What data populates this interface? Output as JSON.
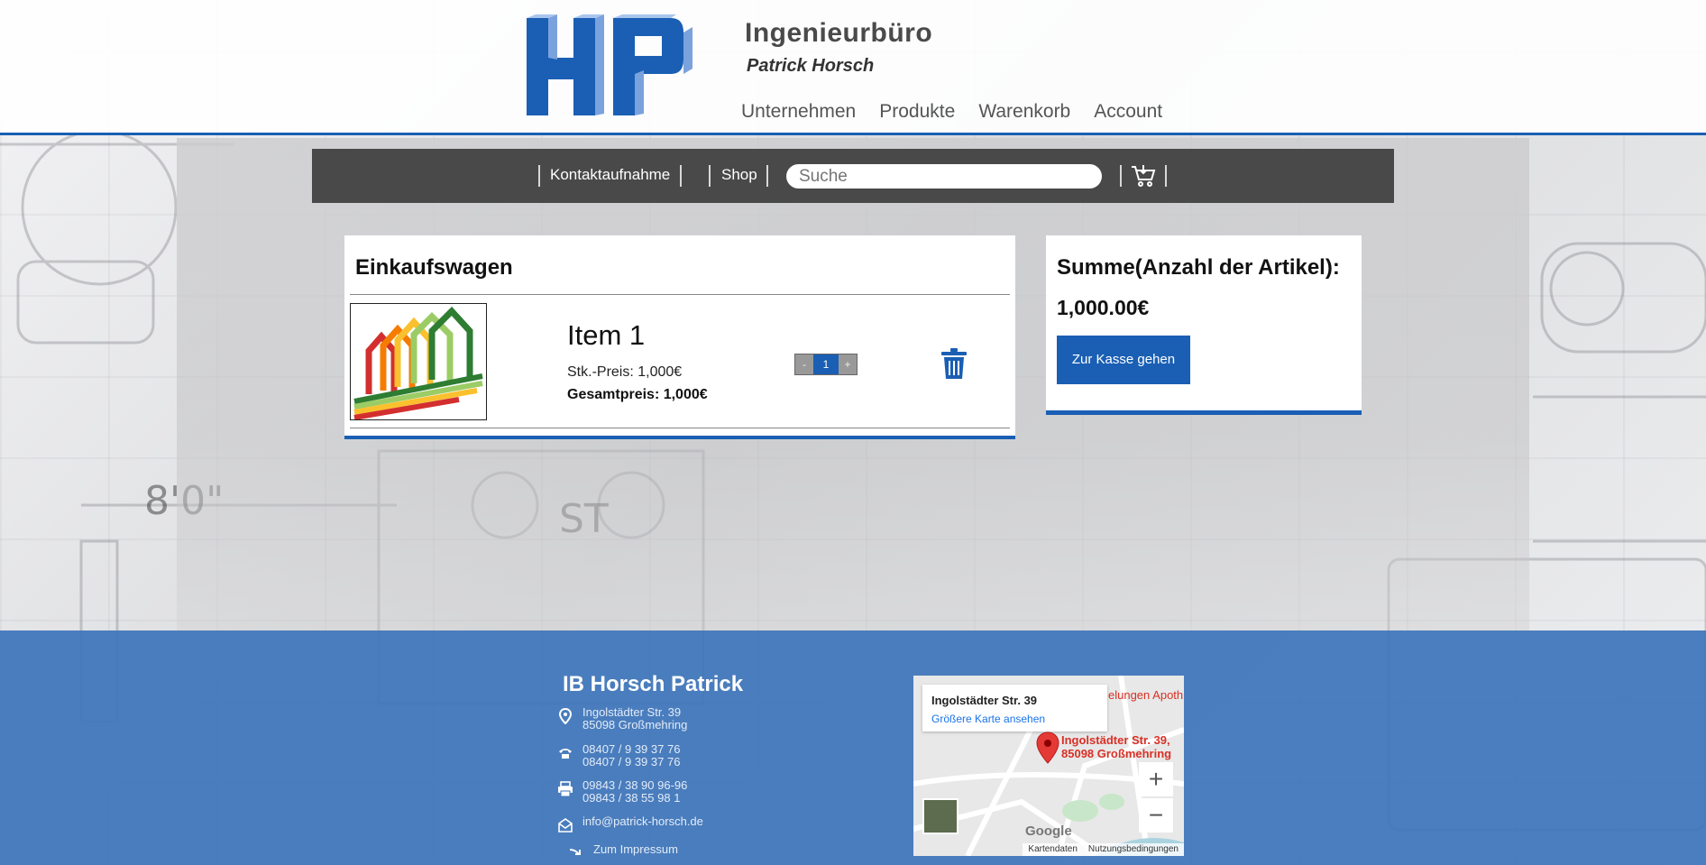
{
  "header": {
    "title": "Ingenieurbüro",
    "subtitle": "Patrick Horsch",
    "logo_text": "HP",
    "nav": [
      "Unternehmen",
      "Produkte",
      "Warenkorb",
      "Account"
    ]
  },
  "toolbar": {
    "contact_label": "Kontaktaufnahme",
    "shop_label": "Shop",
    "search_placeholder": "Suche",
    "cart_icon": "shopping-cart-icon"
  },
  "cart": {
    "title": "Einkaufswagen",
    "items": [
      {
        "name": "Item 1",
        "unit_price": "Stk.-Preis: 1,000€",
        "total_price": "Gesamtpreis: 1,000€",
        "quantity": "1",
        "minus": "-",
        "plus": "+",
        "delete_icon": "trash-icon"
      }
    ]
  },
  "summary": {
    "title": "Summe(Anzahl der Artikel):",
    "total": "1,000.00€",
    "checkout_label": "Zur Kasse gehen"
  },
  "footer": {
    "company": "IB Horsch Patrick",
    "address_line1": "Ingolstädter Str. 39",
    "address_line2": "85098 Großmehring",
    "phone1": "08407 / 9 39 37 76",
    "phone2": "08407 / 9 39 37 76",
    "fax1": "09843 / 38 90 96-96",
    "fax2": "09843 / 38 55 98 1",
    "email": "info@patrick-horsch.de",
    "impressum": "Zum Impressum"
  },
  "map": {
    "info_address": "Ingolstädter Str. 39",
    "info_link": "Größere Karte ansehen",
    "pin_label_line1": "Ingolstädter Str. 39,",
    "pin_label_line2": "85098 Großmehring",
    "top_label": "elungen Apoth",
    "zoom_in": "+",
    "zoom_out": "−",
    "provider": "Google",
    "footer_data": "Kartendaten",
    "footer_terms": "Nutzungsbedingungen"
  },
  "colors": {
    "brand_blue": "#1a5fb4",
    "toolbar_bg": "#4a4949",
    "footer_bg": "#3e75ba"
  }
}
